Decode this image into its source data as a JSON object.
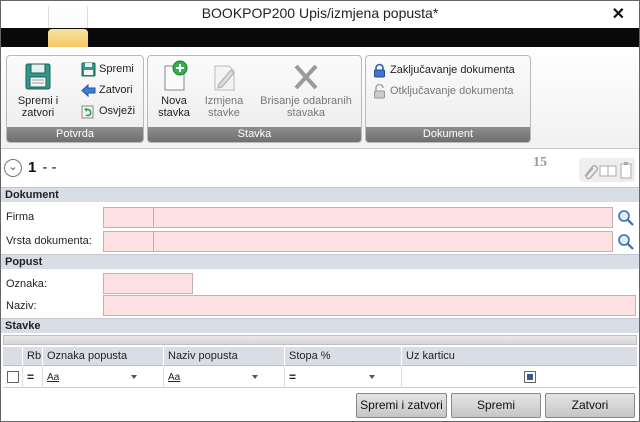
{
  "window": {
    "title": "BOOKPOP200  Upis/izmjena popusta*",
    "close_glyph": "✕"
  },
  "ribbon": {
    "potvrda": {
      "label": "Potvrda",
      "save_close_label_1": "Spremi i",
      "save_close_label_2": "zatvori",
      "save_label": "Spremi",
      "close_label": "Zatvori",
      "refresh_label": "Osvježi"
    },
    "stavka": {
      "label": "Stavka",
      "new_label_1": "Nova",
      "new_label_2": "stavka",
      "edit_label_1": "Izmjena",
      "edit_label_2": "stavke",
      "delete_label_1": "Brisanje odabranih",
      "delete_label_2": "stavaka"
    },
    "dokument": {
      "label": "Dokument",
      "lock_label": "Zaključavanje dokumenta",
      "unlock_label": "Otključavanje dokumenta"
    }
  },
  "record": {
    "expand_glyph": "⌄",
    "number": "1",
    "separators": "-   -",
    "count": "15"
  },
  "sections": {
    "dokument": "Dokument",
    "popust": "Popust",
    "stavke": "Stavke"
  },
  "fields": {
    "firma_label": "Firma",
    "firma_code": "",
    "firma_name": "",
    "vrsta_label": "Vrsta dokumenta:",
    "vrsta_code": "",
    "vrsta_name": "",
    "oznaka_label": "Oznaka:",
    "oznaka_value": "",
    "naziv_label": "Naziv:",
    "naziv_value": ""
  },
  "grid": {
    "columns": [
      "",
      "Rb",
      "Oznaka popusta",
      "Naziv popusta",
      "Stopa %",
      "Uz karticu"
    ],
    "filter_row": {
      "rb_op": "=",
      "oznaka_op": "Aa",
      "naziv_op": "Aa",
      "stopa_op": "="
    }
  },
  "buttons": {
    "save_close": "Spremi i zatvori",
    "save": "Spremi",
    "close": "Zatvori"
  },
  "colors": {
    "required_field_bg": "#fde0e2",
    "section_bg": "#d9dde6",
    "ribbon_group_label_bg": "#7a7a7a",
    "app_tab": "#f2c55a"
  }
}
